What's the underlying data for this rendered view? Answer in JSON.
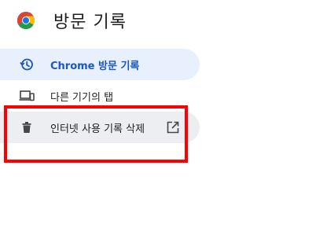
{
  "header": {
    "title": "방문 기록",
    "logo_icon": "chrome-logo-icon"
  },
  "sidebar": {
    "items": [
      {
        "label": "Chrome 방문 기록",
        "icon": "history-icon",
        "selected": true
      },
      {
        "label": "다른 기기의 탭",
        "icon": "devices-icon",
        "selected": false
      },
      {
        "label": "인터넷 사용 기록 삭제",
        "icon": "trash-icon",
        "trailing_icon": "open-in-new-icon",
        "selected": false
      }
    ]
  },
  "colors": {
    "selected_bg": "#e8f0fe",
    "selected_text": "#1a56c4",
    "hover_bg": "#eceef2",
    "highlight_border": "#ff0000"
  }
}
